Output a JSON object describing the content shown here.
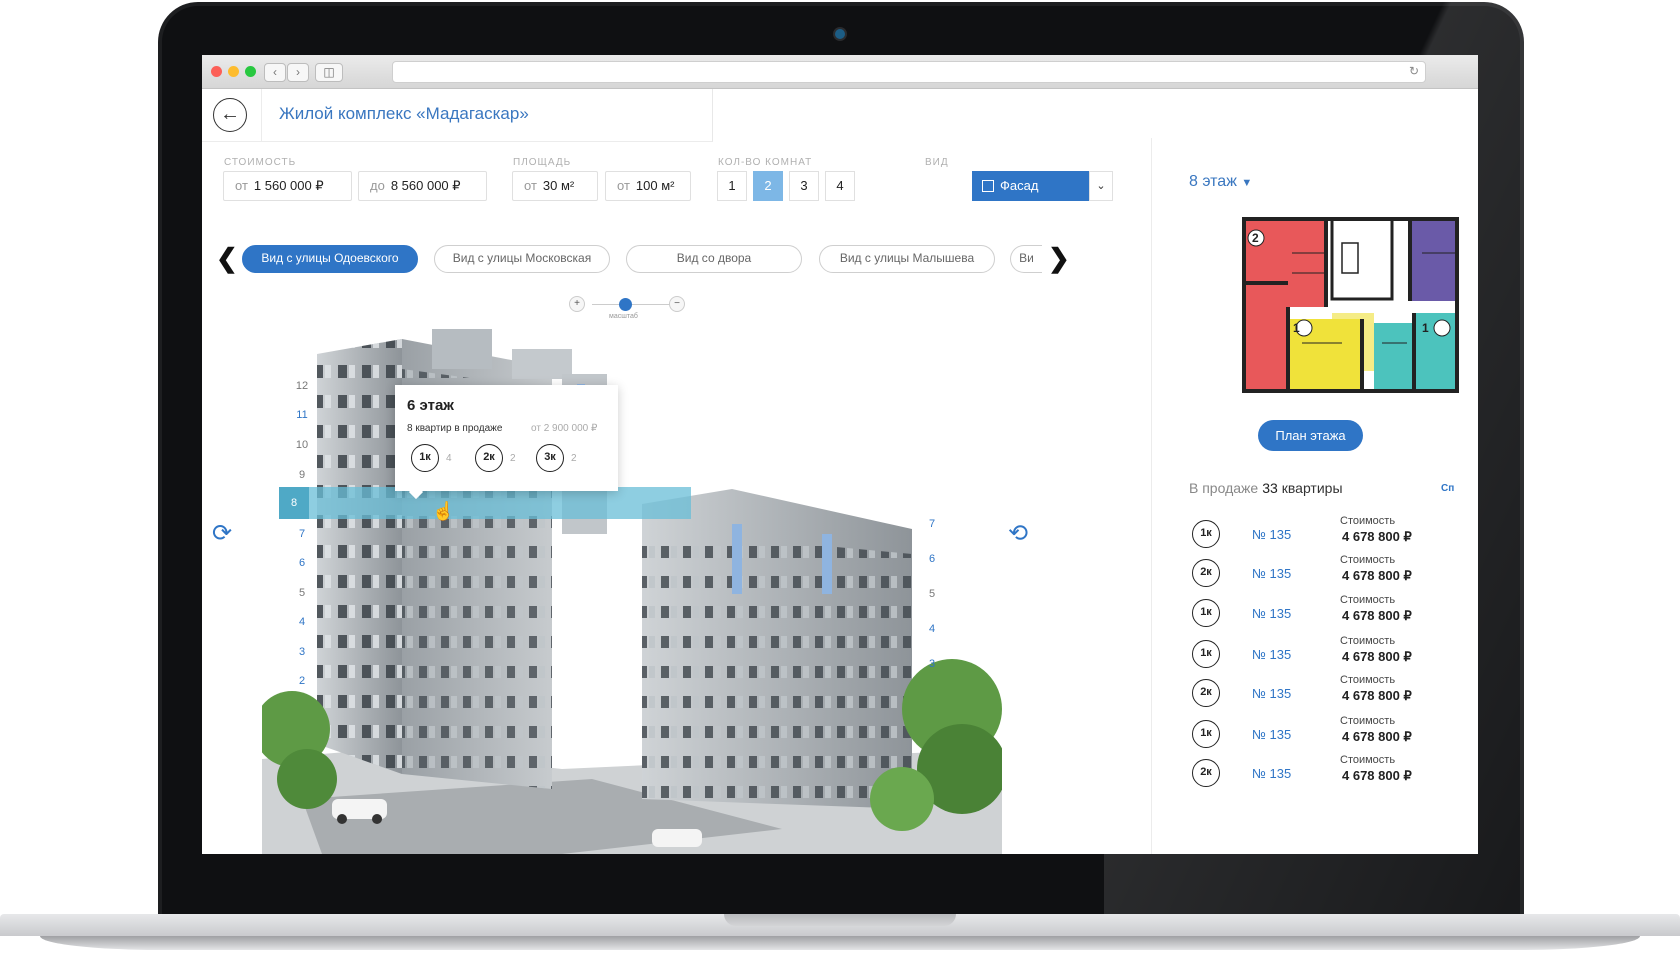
{
  "header": {
    "title": "Жилой комплекс «Мадагаскар»"
  },
  "filters": {
    "price": {
      "label": "СТОИМОСТЬ",
      "from_prefix": "от",
      "from_value": "1 560 000 ₽",
      "to_prefix": "до",
      "to_value": "8 560 000 ₽"
    },
    "area": {
      "label": "ПЛОЩАДЬ",
      "from_prefix": "от",
      "from_value": "30 м²",
      "to_prefix": "от",
      "to_value": "100 м²"
    },
    "rooms": {
      "label": "КОЛ-ВО КОМНАТ",
      "options": [
        "1",
        "2",
        "3",
        "4"
      ],
      "selected": "2"
    },
    "view": {
      "label": "ВИД",
      "selected": "Фасад"
    }
  },
  "view_tabs": [
    "Вид с улицы Одоевского",
    "Вид с улицы Московская",
    "Вид со двора",
    "Вид с улицы Малышева",
    "Ви"
  ],
  "zoom": {
    "label": "масштаб",
    "plus": "+",
    "minus": "−"
  },
  "floors_left": [
    "12",
    "11",
    "10",
    "9",
    "8",
    "7",
    "6",
    "5",
    "4",
    "3",
    "2"
  ],
  "floors_right": [
    "7",
    "6",
    "5",
    "4",
    "3"
  ],
  "tooltip": {
    "title": "6 этаж",
    "subtitle": "8 квартир в продаже",
    "price": "от 2 900 000 ₽",
    "badges": [
      {
        "label": "1к",
        "count": "4"
      },
      {
        "label": "2к",
        "count": "2"
      },
      {
        "label": "3к",
        "count": "2"
      }
    ]
  },
  "floor_selector": "8 этаж",
  "plan_button": "План этажа",
  "sale": {
    "prefix": "В продаже",
    "count": "33",
    "suffix": "квартиры",
    "more": "Сп"
  },
  "apartments": [
    {
      "type": "1к",
      "number": "№ 135",
      "price_label": "Стоимость",
      "price": "4 678 800 ₽"
    },
    {
      "type": "2к",
      "number": "№ 135",
      "price_label": "Стоимость",
      "price": "4 678 800 ₽"
    },
    {
      "type": "1к",
      "number": "№ 135",
      "price_label": "Стоимость",
      "price": "4 678 800 ₽"
    },
    {
      "type": "1к",
      "number": "№ 135",
      "price_label": "Стоимость",
      "price": "4 678 800 ₽"
    },
    {
      "type": "2к",
      "number": "№ 135",
      "price_label": "Стоимость",
      "price": "4 678 800 ₽"
    },
    {
      "type": "1к",
      "number": "№ 135",
      "price_label": "Стоимость",
      "price": "4 678 800 ₽"
    },
    {
      "type": "2к",
      "number": "№ 135",
      "price_label": "Стоимость",
      "price": "4 678 800 ₽"
    }
  ],
  "plan_labels": {
    "room_2": "2",
    "room_1a": "1",
    "room_1b": "1"
  },
  "colors": {
    "accent": "#2f75c6",
    "red": "#e8585a",
    "yellow": "#f0e23a",
    "teal": "#4cc3bd",
    "purple": "#6a5aa8"
  }
}
